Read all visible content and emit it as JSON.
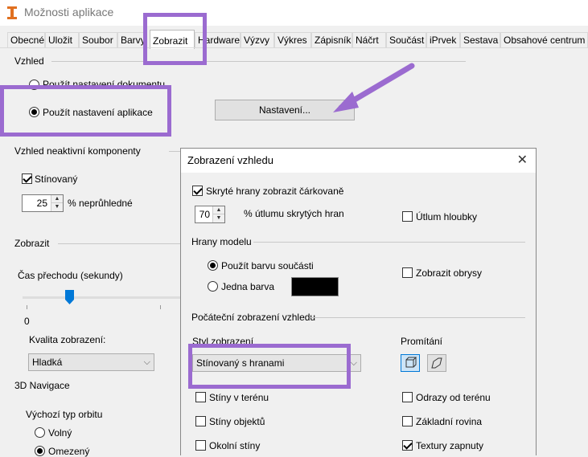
{
  "window": {
    "title": "Možnosti aplikace"
  },
  "tabs": [
    {
      "label": "Obecné"
    },
    {
      "label": "Uložit"
    },
    {
      "label": "Soubor"
    },
    {
      "label": "Barvy"
    },
    {
      "label": "Zobrazit"
    },
    {
      "label": "Hardware"
    },
    {
      "label": "Výzvy"
    },
    {
      "label": "Výkres"
    },
    {
      "label": "Zápisník"
    },
    {
      "label": "Náčrt"
    },
    {
      "label": "Součást"
    },
    {
      "label": "iPrvek"
    },
    {
      "label": "Sestava"
    },
    {
      "label": "Obsahové centrum"
    }
  ],
  "active_tab": "Zobrazit",
  "main": {
    "vzhled": {
      "heading": "Vzhled",
      "opt_document": "Použít nastavení dokumentu",
      "opt_app": "Použít nastavení aplikace",
      "settings_button": "Nastavení..."
    },
    "inactive": {
      "heading": "Vzhled neaktivní komponenty",
      "shaded": "Stínovaný",
      "opacity_value": "25",
      "opacity_label": "% neprůhledné"
    },
    "display": {
      "heading": "Zobrazit",
      "transition_label": "Čas přechodu (sekundy)",
      "slider_min": "0",
      "slider_level": 0.3,
      "quality_label": "Kvalita zobrazení:",
      "quality_value": "Hladká"
    },
    "nav3d": {
      "heading": "3D Navigace",
      "orbit_label": "Výchozí typ orbitu",
      "orbit_free": "Volný",
      "orbit_constrained": "Omezený"
    }
  },
  "dialog": {
    "title": "Zobrazení vzhledu",
    "close_icon": "close-icon",
    "hidden_edges": "Skryté hrany zobrazit čárkovaně",
    "dimming_value": "70",
    "dimming_label": "% útlumu skrytých hran",
    "depth_dimming": "Útlum hloubky",
    "edges_heading": "Hrany modelu",
    "edge_part_color": "Použít barvu součásti",
    "edge_one_color": "Jedna barva",
    "edge_color": "#000000",
    "show_silhouettes": "Zobrazit obrysy",
    "initial_heading": "Počáteční zobrazení vzhledu",
    "style_label": "Styl zobrazení",
    "style_value": "Stínovaný s hranami",
    "projection_label": "Promítání",
    "ground_shadows": "Stíny v terénu",
    "object_shadows": "Stíny objektů",
    "ambient_shadows": "Okolní stíny",
    "ground_reflections": "Odrazy od terénu",
    "ground_plane": "Základní rovina",
    "textures_on": "Textury zapnuty"
  },
  "colors": {
    "annotation": "#9b6bd0",
    "accent": "#0078d7"
  }
}
